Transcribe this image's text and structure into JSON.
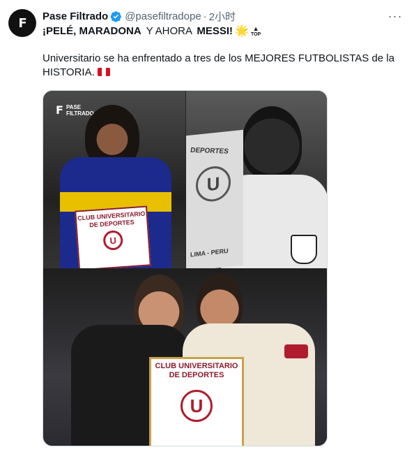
{
  "author": {
    "name": "Pase Filtrado",
    "handle": "@pasefiltradope",
    "separator": "·",
    "time": "2小时",
    "avatar_text": "F"
  },
  "tweet": {
    "line1_bold_a": "¡PELÉ, MARADONA",
    "line1_normal": " Y AHORA ",
    "line1_bold_b": "MESSI!",
    "line1_star": "🌟",
    "line1_top_label": "TOP",
    "line2": "Universitario se ha enfrentado a tres de los MEJORES FUTBOLISTAS de la HISTORIA."
  },
  "media": {
    "logo_line1": "PASE",
    "logo_line2": "FILTRADO",
    "pennant_small_line1": "CLUB UNIVERSITARIO",
    "pennant_small_line2": "DE DEPORTES",
    "pennant_large_line1": "CLUB UNIVERSITARIO",
    "pennant_large_line2": "DE DEPORTES",
    "banner_text_pele": "DEPORTES",
    "banner_text_pele_bottom": "LIMA - PERU",
    "u_letter": "U"
  },
  "colors": {
    "verified": "#1d9bf0",
    "muted": "#536471",
    "universitario_red": "#b01c2e"
  },
  "icons": {
    "verified": "verified-badge-icon",
    "more": "more-options-icon",
    "flag": "peru-flag-icon"
  }
}
